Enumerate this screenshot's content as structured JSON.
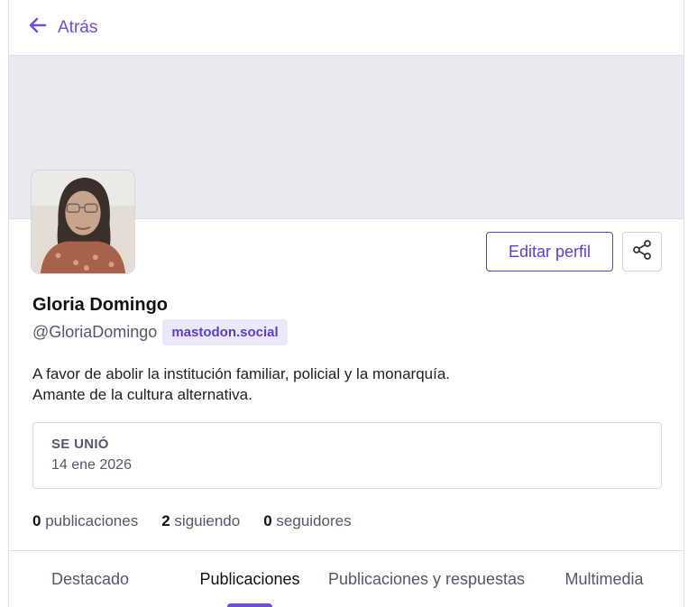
{
  "topbar": {
    "back_label": "Atrás"
  },
  "profile": {
    "display_name": "Gloria Domingo",
    "handle": "@GloriaDomingo",
    "server": "mastodon.social",
    "bio_line1": "A favor de abolir la institución familiar, policial y la monarquía.",
    "bio_line2": "Amante de la cultura alternativa.",
    "edit_label": "Editar perfil",
    "joined_label": "SE UNIÓ",
    "joined_date": "14 ene 2026"
  },
  "stats": [
    {
      "count": "0",
      "label": "publicaciones"
    },
    {
      "count": "2",
      "label": "siguiendo"
    },
    {
      "count": "0",
      "label": "seguidores"
    }
  ],
  "tabs": [
    {
      "label": "Destacado",
      "active": false
    },
    {
      "label": "Publicaciones",
      "active": true
    },
    {
      "label": "Publicaciones y respuestas",
      "active": false
    },
    {
      "label": "Multimedia",
      "active": false
    }
  ],
  "colors": {
    "accent": "#6d4fd7",
    "badge_bg": "#ece8fb",
    "banner": "#e9eaef"
  },
  "icons": {
    "back": "arrow-left-icon",
    "share": "share-icon"
  }
}
